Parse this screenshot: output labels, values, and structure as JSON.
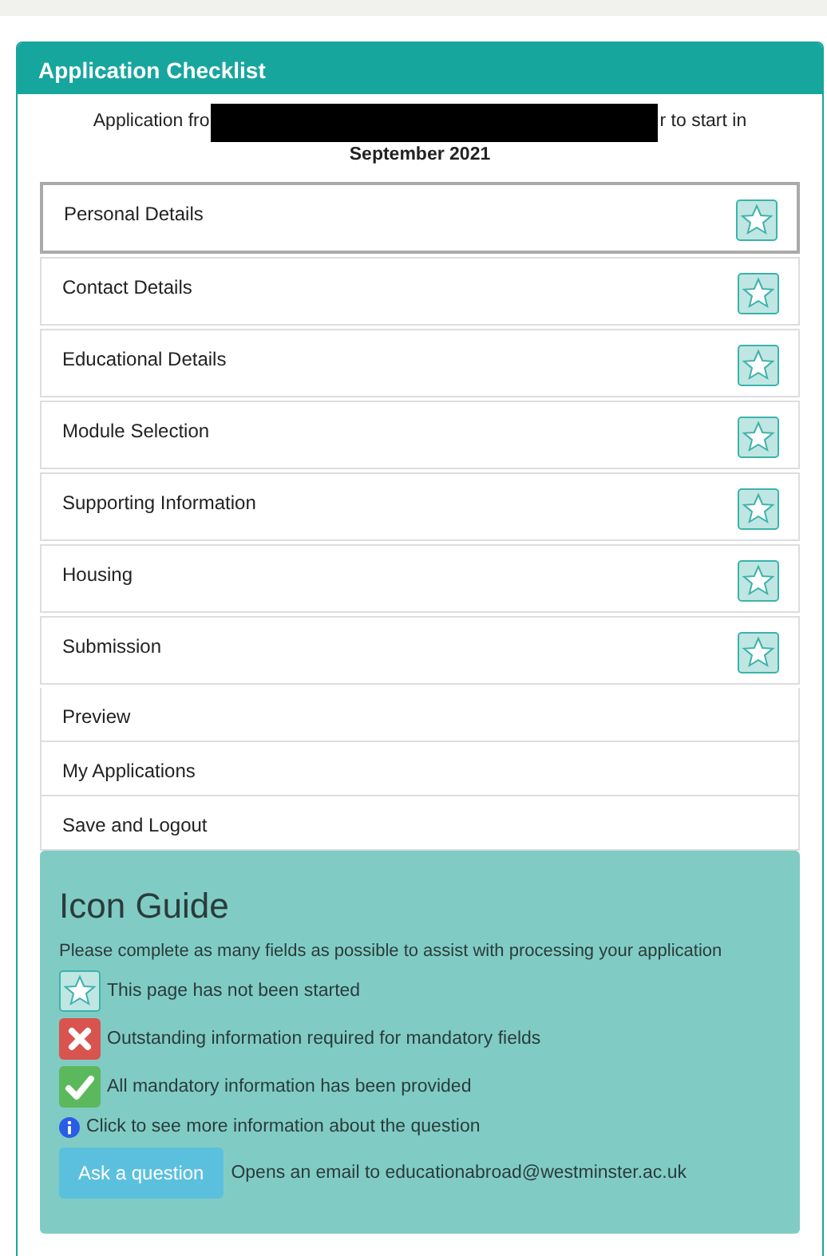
{
  "panel": {
    "title": "Application Checklist"
  },
  "intro": {
    "before": "Application fro",
    "after": "r to start in",
    "line2": "September 2021",
    "redacted": true
  },
  "items": [
    {
      "label": "Personal Details",
      "kind": "status",
      "started": false,
      "selected": true
    },
    {
      "label": "Contact Details",
      "kind": "status",
      "started": false,
      "selected": false
    },
    {
      "label": "Educational Details",
      "kind": "status",
      "started": false,
      "selected": false
    },
    {
      "label": "Module Selection",
      "kind": "status",
      "started": false,
      "selected": false
    },
    {
      "label": "Supporting Information",
      "kind": "status",
      "started": false,
      "selected": false
    },
    {
      "label": "Housing",
      "kind": "status",
      "started": false,
      "selected": false
    },
    {
      "label": "Submission",
      "kind": "status",
      "started": false,
      "selected": false
    },
    {
      "label": "Preview",
      "kind": "link",
      "selected": false
    },
    {
      "label": "My Applications",
      "kind": "link",
      "selected": false
    },
    {
      "label": "Save and Logout",
      "kind": "link",
      "selected": false
    }
  ],
  "icon_guide": {
    "title": "Icon Guide",
    "note": "Please complete as many fields as possible to assist with processing your application",
    "entries": [
      {
        "kind": "not_started",
        "text": "This page has not been started"
      },
      {
        "kind": "outstanding",
        "text": "Outstanding information required for mandatory fields"
      },
      {
        "kind": "complete",
        "text": "All mandatory information has been provided"
      },
      {
        "kind": "info",
        "text": "Click to see more information about the question"
      },
      {
        "kind": "button",
        "button": "Ask a question",
        "text": "Opens an email to educationabroad@westminster.ac.uk"
      }
    ]
  }
}
